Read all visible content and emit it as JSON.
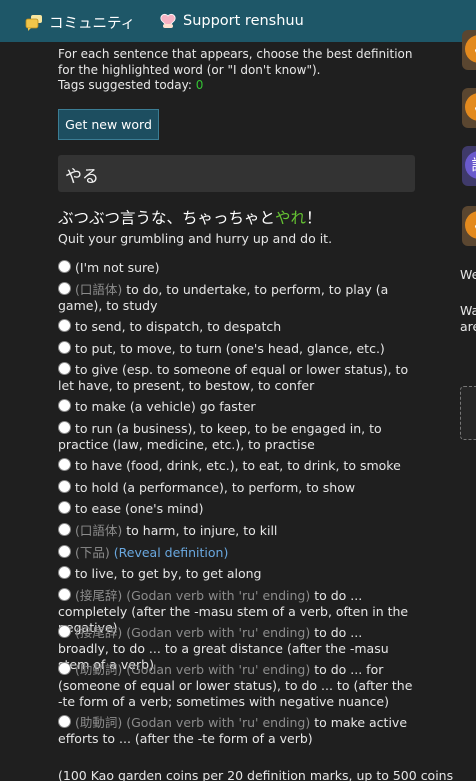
{
  "topbar": {
    "community_label": "コミュニティ",
    "support_label": "Support renshuu",
    "community_icon": "chat-bubbles-icon",
    "support_icon": "heart-hand-icon"
  },
  "intro": {
    "text": "For each sentence that appears, choose the best definition for the highlighted word (or \"I don't know\").",
    "tags_label": "Tags suggested today:",
    "tags_count": "0"
  },
  "get_button_label": "Get new word",
  "word": "やる",
  "sentence": {
    "before": "ぶつぶつ言うな、ちゃっちゃと",
    "highlight": "やれ",
    "after": "！",
    "translation": "Quit your grumbling and hurry up and do it."
  },
  "options": [
    {
      "tag": "",
      "text": "(I'm not sure)"
    },
    {
      "tag": "(口語体)",
      "text": "to do, to undertake, to perform, to play (a game), to study"
    },
    {
      "tag": "",
      "text": "to send, to dispatch, to despatch"
    },
    {
      "tag": "",
      "text": "to put, to move, to turn (one's head, glance, etc.)"
    },
    {
      "tag": "",
      "text": "to give (esp. to someone of equal or lower status), to let have, to present, to bestow, to confer"
    },
    {
      "tag": "",
      "text": "to make (a vehicle) go faster"
    },
    {
      "tag": "",
      "text": "to run (a business), to keep, to be engaged in, to practice (law, medicine, etc.), to practise"
    },
    {
      "tag": "",
      "text": "to have (food, drink, etc.), to eat, to drink, to smoke"
    },
    {
      "tag": "",
      "text": "to hold (a performance), to perform, to show"
    },
    {
      "tag": "",
      "text": "to ease (one's mind)"
    },
    {
      "tag": "(口語体)",
      "text": "to harm, to injure, to kill"
    },
    {
      "tag": "(下品)",
      "text": "",
      "reveal": "(Reveal definition)"
    },
    {
      "tag": "",
      "text": "to live, to get by, to get along"
    },
    {
      "tag": "(接尾辞) (Godan verb with 'ru' ending)",
      "text": "to do ... completely (after the -masu stem of a verb, often in the negative)"
    },
    {
      "tag": "(接尾辞) (Godan verb with 'ru' ending)",
      "text": "to do ... broadly, to do ... to a great distance (after the -masu stem of a verb)"
    },
    {
      "tag": "(助動詞) (Godan verb with 'ru' ending)",
      "text": "to do ... for (someone of equal or lower status), to do ... to (after the -te form of a verb; sometimes with negative nuance)"
    },
    {
      "tag": "(助動詞) (Godan verb with 'ru' ending)",
      "text": "to make active efforts to ... (after the -te form of a verb)"
    }
  ],
  "footer_note": "(100 Kao garden coins per 20 definition marks, up to 500 coins",
  "sidebar": {
    "icon1": "読",
    "text_we": "We",
    "text_wa": "Wa",
    "text_are": "are"
  },
  "colors": {
    "topbar": "#1e5768",
    "highlight": "#64c232",
    "tags_count": "#33c233",
    "button": "#1d4e60",
    "reveal_link": "#6aa8df"
  }
}
